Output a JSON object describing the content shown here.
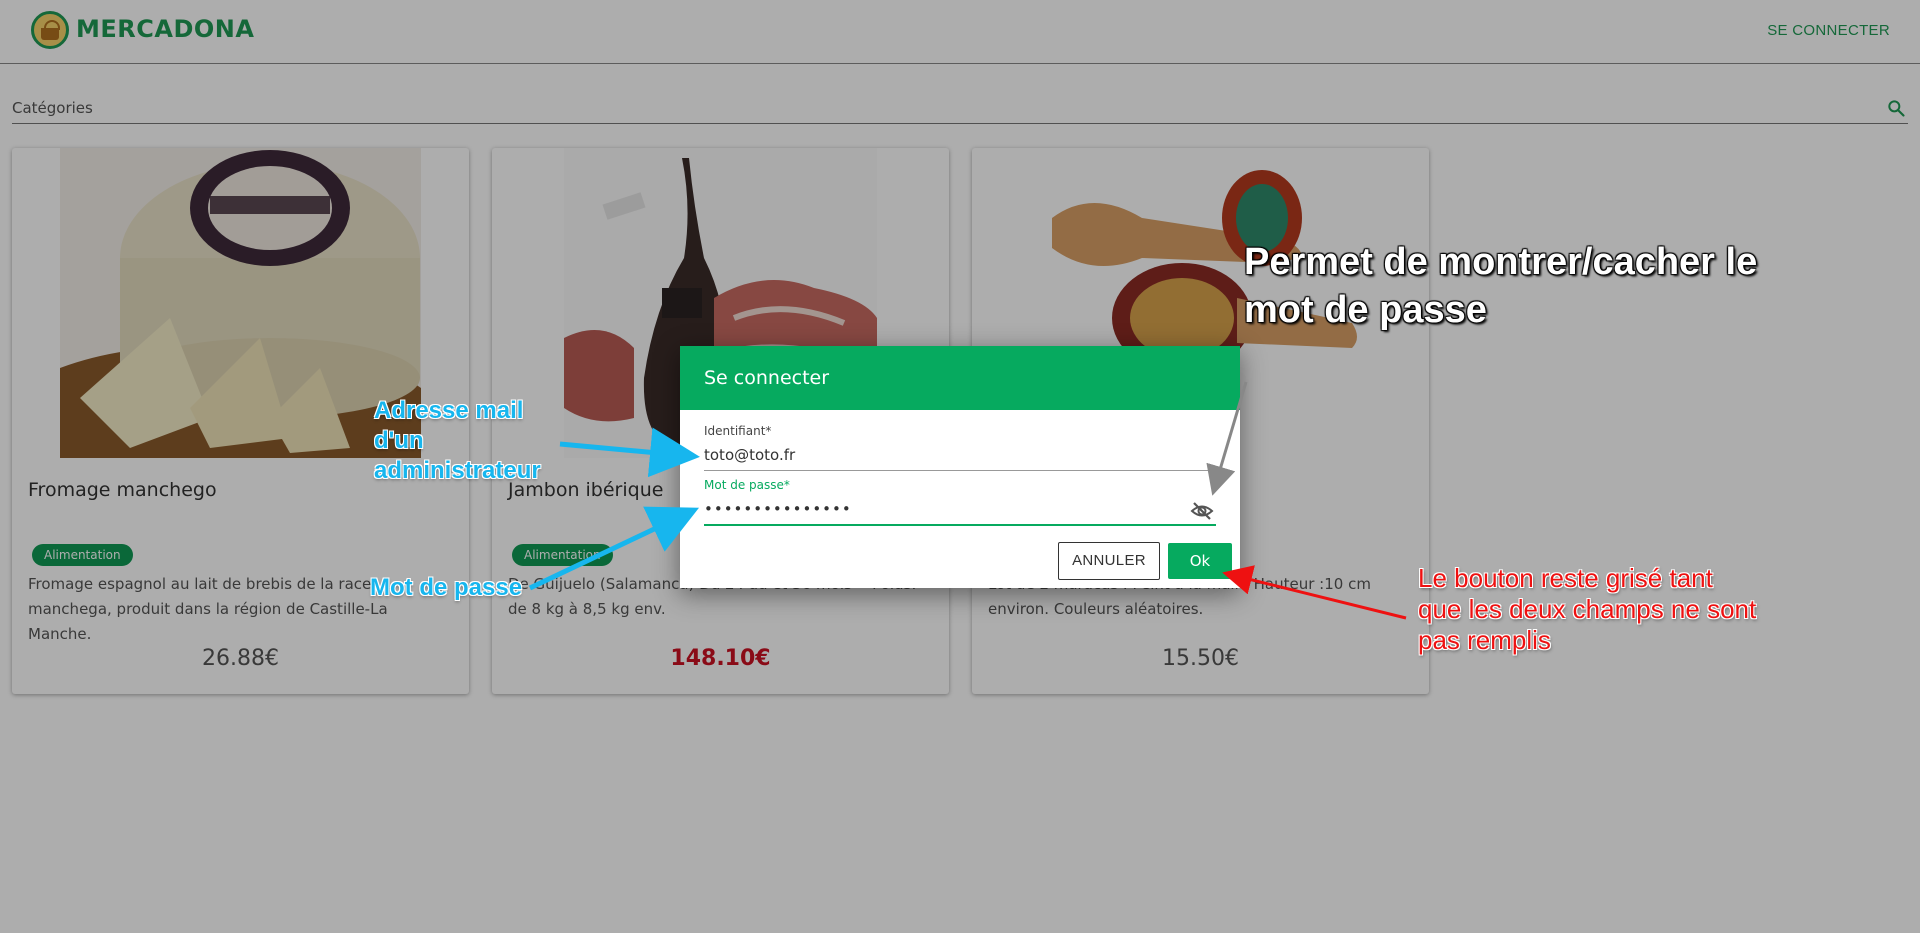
{
  "header": {
    "brand": "MERCADONA",
    "connect_label": "SE CONNECTER"
  },
  "categories": {
    "label": "Catégories"
  },
  "products": [
    {
      "title": "Fromage manchego",
      "badge": "Alimentation",
      "description": "Fromage espagnol au lait de brebis de la race manchega, produit dans la région de Castille-La Manche.",
      "price": "26.88€",
      "promo": false
    },
    {
      "title": "Jambon ibérique",
      "badge": "Alimentation",
      "description": "De Guijuelo (Salamanca) Du 24 au et 36 mois -- Poids: de 8 kg à 8,5 kg env.",
      "price": "148.10€",
      "promo": true
    },
    {
      "title": "",
      "badge": "",
      "description": "Lot de 2 maracas . Peint à la main. Hauteur :10 cm environ. Couleurs aléatoires.",
      "price": "15.50€",
      "promo": false
    }
  ],
  "dialog": {
    "title": "Se connecter",
    "login_label": "Identifiant*",
    "login_value": "toto@toto.fr",
    "password_label": "Mot de passe*",
    "password_value": "•••••••••••••••",
    "cancel_label": "ANNULER",
    "ok_label": "Ok"
  },
  "annotations": {
    "admin_email": "Adresse mail d'un administrateur",
    "password": "Mot de passe",
    "toggle_password": "Permet de montrer/cacher le mot de passe",
    "button_disabled": "Le bouton reste grisé tant que les deux champs ne sont pas remplis"
  },
  "colors": {
    "brand_green": "#1f9a55",
    "dialog_green": "#06aa5f",
    "promo_red": "#cc1122",
    "annotation_blue": "#17b6ee",
    "annotation_red": "#ee1111"
  }
}
